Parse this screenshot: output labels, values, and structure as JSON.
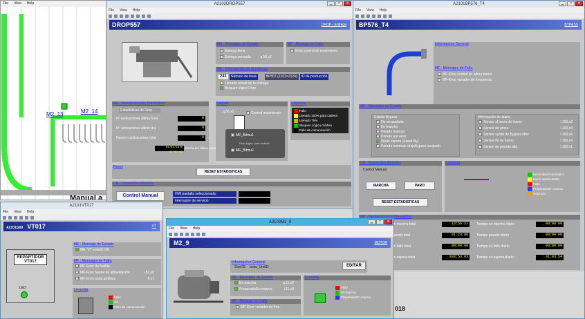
{
  "bg_win": {
    "menu": [
      "File",
      "View",
      "Help"
    ],
    "labels": {
      "m2_13": "M2_13",
      "m2_14": "M2_14",
      "manual": "Manual a"
    }
  },
  "drop": {
    "title": "A2102DROP557",
    "menu": [
      "File",
      "View",
      "Help"
    ],
    "header": "DROP557",
    "header_link": "DROP - Entrega",
    "me_estado": {
      "title": "ME - Mensajes de Estado",
      "items": [
        "Entrega llena",
        "Entrega activada"
      ],
      "addr": "q.56,x2"
    },
    "mf_fallo": {
      "title": "MF - Mensaje de Fallo",
      "items": [
        "Error control de movimiento"
      ]
    },
    "info": {
      "title": "ME - Información de la entrega",
      "id": "241",
      "num_label": "Número de linea",
      "code": "BP557 (2102>2124)",
      "id_label": "ID de producción",
      "items": [
        "Llenado actual de la entrega",
        "Bloqueo lógico Drop"
      ]
    },
    "mp": {
      "title": "MP - Mantenimiento Preventivo",
      "sub": "Estadísticas de Drop",
      "rows": [
        {
          "label": "Nº activaciones ultima hora",
          "value": "0"
        },
        {
          "label": "Nº activaciones ultimo día",
          "value": "0"
        },
        {
          "label": "Numero activaciones total",
          "value": "0"
        }
      ],
      "reset_date": "01/01/1970 01:00:00",
      "reset_label": "Fecha del ultimo reset"
    },
    "layout": {
      "title": "Layout",
      "addr": "q.56,x2",
      "control": "Control movimiento",
      "mel1": "ME_Bitmu1",
      "mel1_sub": "Drop lógico para cadena",
      "mel2": "ME_Bitmu2"
    },
    "leyenda": {
      "title": "Leyenda",
      "items": [
        {
          "label": "Fallo",
          "color": "#ff0000"
        },
        {
          "label": "Llenado 100% para cadena",
          "color": "#ffff00"
        },
        {
          "label": "Llenado 75%",
          "color": "#ff9900"
        },
        {
          "label": "Bloqueo Lógico módulo",
          "color": "#00cc00"
        },
        {
          "label": "Fallo de comunicación",
          "color": "#000000"
        }
      ]
    },
    "reset": {
      "title": "Reset",
      "button": "RESET ESTADISTICAS"
    },
    "cb": {
      "title": "CB - Comandos Binarios",
      "button": "Control Manual",
      "hmi": "HMI pantalla seleccionada:",
      "int": "Interruptor de servicio:"
    }
  },
  "bp": {
    "title": "A2101BP576_T4",
    "header": "BP576_T4",
    "header_link": "BYPASS",
    "info": {
      "title": "Informacion General"
    },
    "mf": {
      "title": "MF - Mensajes de Fallo",
      "items": [
        "MF-Error control de altura tramo",
        "MF-Error variador de frecuencia"
      ]
    },
    "me": {
      "title": "ME - Mensajes de Estado",
      "bypass_title": "Estado Bypass",
      "bypass": [
        "No encaudado",
        "En marcha",
        "Parado manual",
        "Parado por error",
        "Modo espera (Stand-By)",
        "Parada mientras drop/bypass ocupado"
      ],
      "diario_title": "Información de diario",
      "diario": [
        {
          "label": "Sensor al inicio del tramo",
          "addr": "i.100,x2"
        },
        {
          "label": "Sensor de pinza",
          "addr": "i.100,x3"
        },
        {
          "label": "Sensor salida de Bypass libre",
          "addr": "i.100,x6"
        },
        {
          "label": "Sensor fin de tramo",
          "addr": "i.100,x4"
        },
        {
          "label": "Sensor de prenda alta",
          "addr": "i.100,x1"
        }
      ]
    },
    "cb": {
      "title": "CB - Comandos Binarios",
      "sub": "Control Manual",
      "marcha": "MARCHA",
      "paro": "PARO",
      "reset": "RESET ESTADISTICAS"
    },
    "leyenda": {
      "title": "Leyenda",
      "items": [
        {
          "label": "Encendido/Automatico",
          "color": "#00cc00"
        },
        {
          "label": "Modo servicio/Mtto",
          "color": "#ffff00"
        },
        {
          "label": "Fallo",
          "color": "#ff0000"
        },
        {
          "label": "Preparado/En espera",
          "color": "#3333ff"
        },
        {
          "label": "Saturado",
          "color": "#ff9900"
        }
      ]
    },
    "mp": {
      "title": "MP - Mantenimiento Preventivo",
      "rows": [
        {
          "l": "Tiempo en marcha total",
          "v": "13:56:37",
          "l2": "Tiempo en marcha diario",
          "v2": "00:00:00"
        },
        {
          "l": "Tiempo parado total",
          "v": "91:23:06",
          "l2": "Tiempo parado diario",
          "v2": "00:00:00"
        },
        {
          "l": "Tiempo en fallo total",
          "v": "00:00:00",
          "l2": "Tiempo en fallo diario",
          "v2": "00:00:00"
        },
        {
          "l": "Tiempo en espera total",
          "v": "838:53:03",
          "l2": "Tiempo en espera diario",
          "v2": "01:03:54"
        }
      ],
      "partial_labels": [
        "marcha total",
        "parado total",
        "fallo total",
        "espera total"
      ]
    }
  },
  "vt": {
    "title": "A2101VT017",
    "menu": [
      "File",
      "View",
      "Help"
    ],
    "prefix": "A2101G00",
    "header": "VT017",
    "header_link": "VT",
    "box_label": "REPARTIDOR VT017",
    "led": "LED",
    "me": {
      "title": "ME - Mensaje de Estado",
      "items": [
        "ME- VT estado OK"
      ]
    },
    "mf": {
      "title": "MF - Mensajes de Fallo",
      "items": [
        {
          "label": "MF-Error de fusible",
          "addr": ""
        },
        {
          "label": "MF-Error fuente de alimentación",
          "addr": "i.52,x0"
        },
        {
          "label": "MF-Error sodo profibus",
          "addr": "fi,x1"
        }
      ]
    },
    "leyenda": {
      "title": "Leyenda",
      "items": [
        {
          "label": "Fallo",
          "color": "#ff0000"
        },
        {
          "label": "OK",
          "color": "#00cc00"
        },
        {
          "label": "Fallo de comunicación",
          "color": "#000000"
        }
      ]
    }
  },
  "m2": {
    "title": "A2102M2_9",
    "menu": [
      "File",
      "View",
      "Help"
    ],
    "header": "M2_9",
    "header_link": "MOTOR",
    "info": {
      "title": "Informacion General",
      "stat_label": "Stat ID:",
      "stat_value": "texto_UnitID",
      "edit": "EDITAR"
    },
    "me": {
      "title": "ME - Mensajes de Estado",
      "items": [
        {
          "label": "En marcha",
          "addr": "q.11,x0"
        },
        {
          "label": "Preparado/En espera",
          "addr": "i.11,x0"
        }
      ]
    },
    "mf": {
      "title": "MF - Mensaje de Fallo",
      "items": [
        "MF-Error variador de frec."
      ]
    },
    "leyenda": {
      "title": "Leyenda",
      "items": [
        {
          "label": "Fallo",
          "color": "#ff0000"
        },
        {
          "label": "En marcha",
          "color": "#00cc00"
        },
        {
          "label": "Preparado/En espera",
          "color": "#3333ff"
        }
      ]
    }
  },
  "misc": {
    "bottom_text": "018"
  }
}
